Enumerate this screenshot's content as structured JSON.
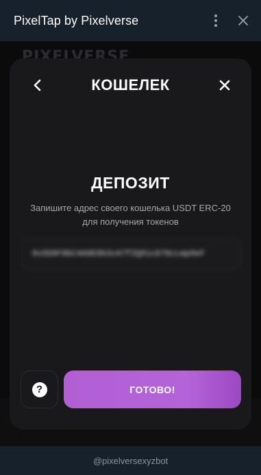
{
  "window": {
    "title": "PixelTap by Pixelverse",
    "icons": {
      "menu": "more-vertical-icon",
      "close": "close-icon"
    }
  },
  "background": {
    "peek_title": "PIXELVERSE"
  },
  "modal": {
    "title": "КОШЕЛЕК",
    "back_icon": "chevron-left-icon",
    "close_icon": "close-icon",
    "deposit_title": "ДЕПОЗИТ",
    "description_line1": "Запишите адрес своего кошелька USDT ERC-20",
    "description_line2": "для получения токенов",
    "wallet_address": "0x5D9F8bC4A9E6b3cA7f2Q91cD78cLmp9eF",
    "help_icon": "question-circle-icon",
    "done_label": "ГОТОВО!"
  },
  "footer": {
    "bot_username": "@pixelversexyzbot"
  },
  "colors": {
    "header_bg": "#17212b",
    "modal_bg": "#19191b",
    "accent": "#b25fd4",
    "text_primary": "#ffffff",
    "text_secondary": "#a7a7ab"
  }
}
